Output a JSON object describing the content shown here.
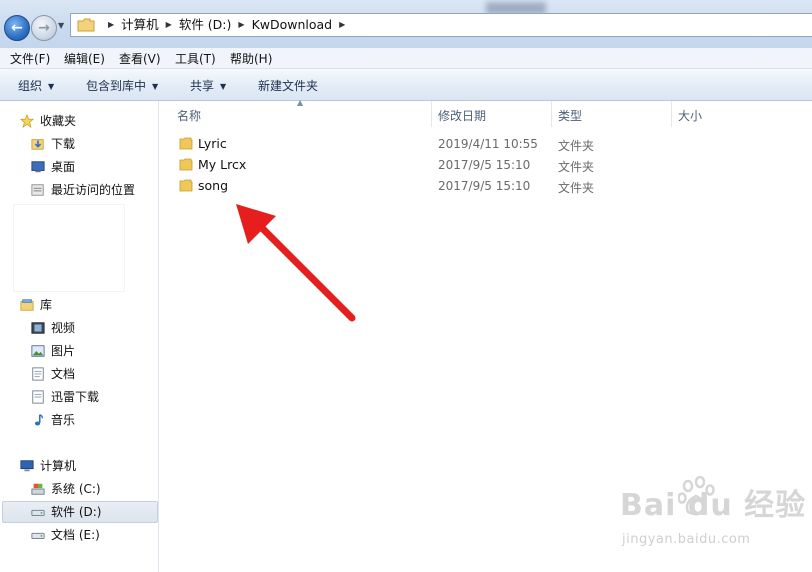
{
  "address_bar": {
    "breadcrumbs": [
      "计算机",
      "软件 (D:)",
      "KwDownload"
    ]
  },
  "menu": [
    "文件(F)",
    "编辑(E)",
    "查看(V)",
    "工具(T)",
    "帮助(H)"
  ],
  "toolbar": {
    "organize": "组织",
    "include_in_library": "包含到库中",
    "share": "共享",
    "new_folder": "新建文件夹"
  },
  "nav": {
    "favorites": {
      "header": "收藏夹",
      "items": [
        "下载",
        "桌面",
        "最近访问的位置"
      ]
    },
    "libraries": {
      "header": "库",
      "items": [
        "视频",
        "图片",
        "文档",
        "迅雷下载",
        "音乐"
      ]
    },
    "computer": {
      "header": "计算机",
      "items": [
        "系统 (C:)",
        "软件 (D:)",
        "文档 (E:)"
      ]
    }
  },
  "columns": [
    "名称",
    "修改日期",
    "类型",
    "大小"
  ],
  "files": [
    {
      "name": "Lyric",
      "date": "2019/4/11 10:55",
      "type": "文件夹"
    },
    {
      "name": "My Lrcx",
      "date": "2017/9/5 15:10",
      "type": "文件夹"
    },
    {
      "name": "song",
      "date": "2017/9/5 15:10",
      "type": "文件夹"
    }
  ],
  "watermark": {
    "logo": "Bai du 经验",
    "url": "jingyan.baidu.com"
  },
  "colors": {
    "folder": "#e8c35a",
    "arrow": "#e61e1e",
    "selection": "#dde4ec"
  }
}
